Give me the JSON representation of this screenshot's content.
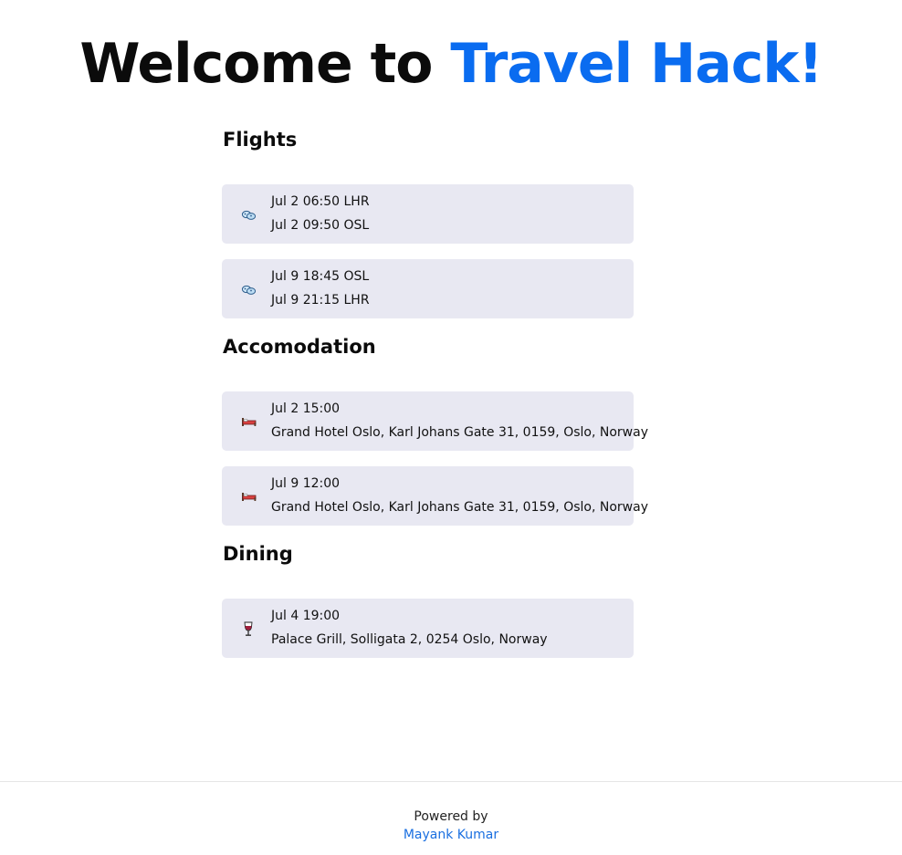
{
  "hero": {
    "prefix": "Welcome to ",
    "brand": "Travel Hack!"
  },
  "sections": {
    "flights": {
      "title": "Flights",
      "items": [
        {
          "icon": "airplane-icon",
          "line1": "Jul 2 06:50 LHR",
          "line2": "Jul 2 09:50 OSL"
        },
        {
          "icon": "airplane-icon",
          "line1": "Jul 9 18:45 OSL",
          "line2": "Jul 9 21:15 LHR"
        }
      ]
    },
    "accommodation": {
      "title": "Accomodation",
      "items": [
        {
          "icon": "bed-icon",
          "line1": "Jul 2 15:00",
          "line2": "Grand Hotel Oslo, Karl Johans Gate 31, 0159, Oslo, Norway"
        },
        {
          "icon": "bed-icon",
          "line1": "Jul 9 12:00",
          "line2": "Grand Hotel Oslo, Karl Johans Gate 31, 0159, Oslo, Norway"
        }
      ]
    },
    "dining": {
      "title": "Dining",
      "items": [
        {
          "icon": "wine-glass-icon",
          "line1": "Jul 4 19:00",
          "line2": "Palace Grill, Solligata 2, 0254 Oslo, Norway"
        }
      ]
    }
  },
  "footer": {
    "powered_by": "Powered by",
    "author": "Mayank Kumar"
  },
  "colors": {
    "brand": "#0a6cf0",
    "card_bg": "#e8e8f2",
    "link": "#1a6fe0"
  }
}
